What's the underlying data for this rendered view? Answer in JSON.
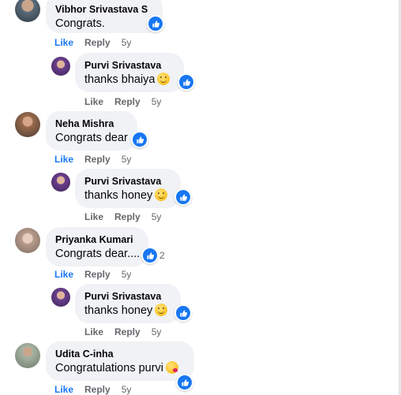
{
  "comments": [
    {
      "name": "Vibhor Srivastava S",
      "text": "Congrats.",
      "like": "Like",
      "reply": "Reply",
      "time": "5y",
      "liked": true
    },
    {
      "name": "Purvi Srivastava",
      "text": "thanks bhaiya",
      "like": "Like",
      "reply": "Reply",
      "time": "5y"
    },
    {
      "name": "Neha Mishra",
      "text": "Congrats dear",
      "like": "Like",
      "reply": "Reply",
      "time": "5y",
      "liked": true
    },
    {
      "name": "Purvi Srivastava",
      "text": "thanks honey",
      "like": "Like",
      "reply": "Reply",
      "time": "5y"
    },
    {
      "name": "Priyanka Kumari",
      "text": "Congrats dear....",
      "like": "Like",
      "reply": "Reply",
      "time": "5y",
      "liked": true,
      "reaction_count": "2"
    },
    {
      "name": "Purvi Srivastava",
      "text": "thanks honey",
      "like": "Like",
      "reply": "Reply",
      "time": "5y"
    },
    {
      "name": "Udita C-inha",
      "text": "Congratulations purvi",
      "like": "Like",
      "reply": "Reply",
      "time": "5y",
      "liked": true
    }
  ],
  "colors": {
    "accent": "#1877f2",
    "bubble": "#f0f2f5",
    "meta": "#65676b"
  }
}
